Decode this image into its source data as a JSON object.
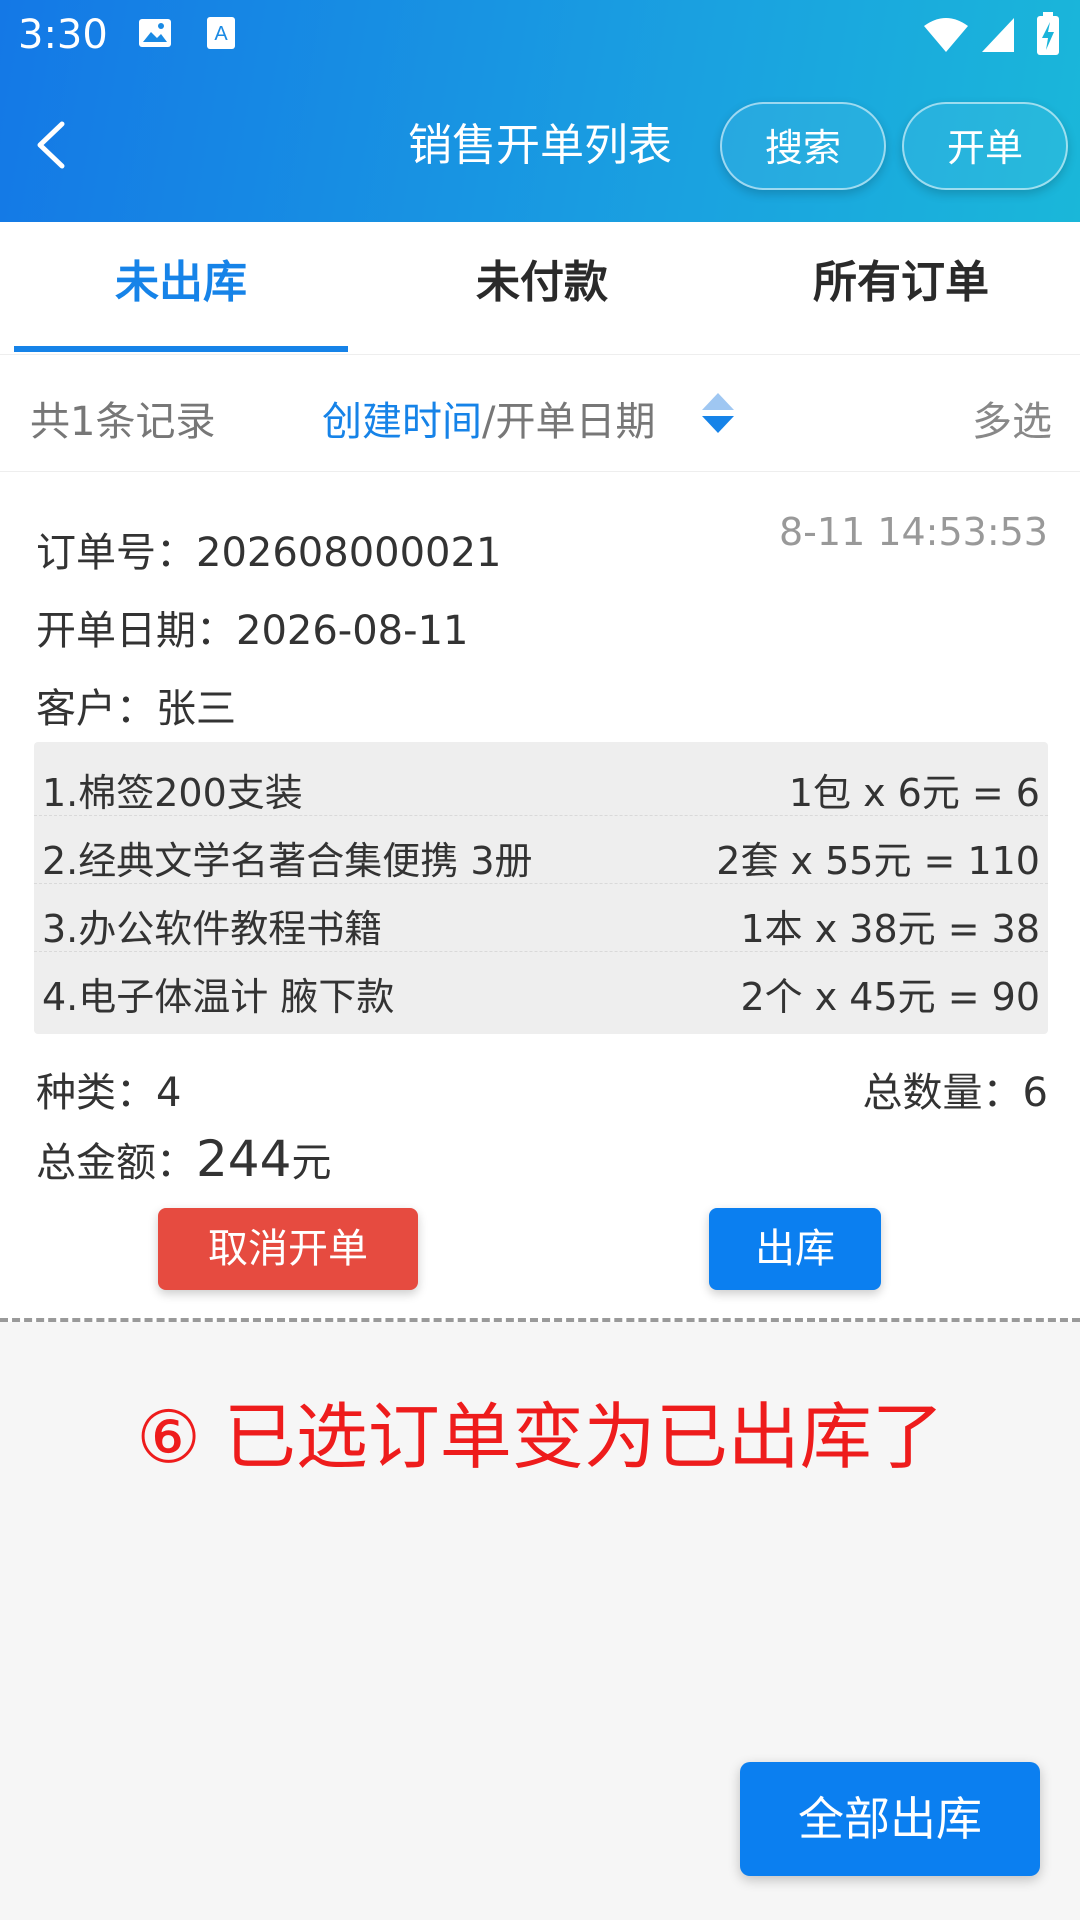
{
  "status_bar": {
    "time": "3:30"
  },
  "header": {
    "title": "销售开单列表",
    "search_label": "搜索",
    "new_order_label": "开单"
  },
  "tabs": [
    {
      "label": "未出库",
      "active": true
    },
    {
      "label": "未付款",
      "active": false
    },
    {
      "label": "所有订单",
      "active": false
    }
  ],
  "filter": {
    "count_text": "共1条记录",
    "sort_active": "创建时间",
    "sort_sep": "/",
    "sort_other": "开单日期",
    "multi_select": "多选"
  },
  "order": {
    "order_no_label": "订单号：",
    "order_no": "202608000021",
    "timestamp": "8-11 14:53:53",
    "date_label": "开单日期：",
    "date": "2026-08-11",
    "customer_label": "客户：",
    "customer": "张三",
    "items": [
      {
        "name": "1.棉签200支装",
        "calc": "1包 x 6元 = 6"
      },
      {
        "name": "2.经典文学名著合集便携 3册",
        "calc": "2套 x 55元 = 110"
      },
      {
        "name": "3.办公软件教程书籍",
        "calc": "1本 x 38元 = 38"
      },
      {
        "name": "4.电子体温计 腋下款",
        "calc": "2个 x 45元 = 90"
      }
    ],
    "kinds_label": "种类：",
    "kinds": "4",
    "qty_label": "总数量：",
    "qty": "6",
    "total_label": "总金额：",
    "total": "244",
    "total_unit": "元",
    "cancel_label": "取消开单",
    "out_label": "出库"
  },
  "annotation": "⑥ 已选订单变为已出库了",
  "footer": {
    "all_out_label": "全部出库"
  },
  "colors": {
    "accent": "#1683e8",
    "danger": "#e64b40",
    "annotation": "#ee1c1c"
  }
}
